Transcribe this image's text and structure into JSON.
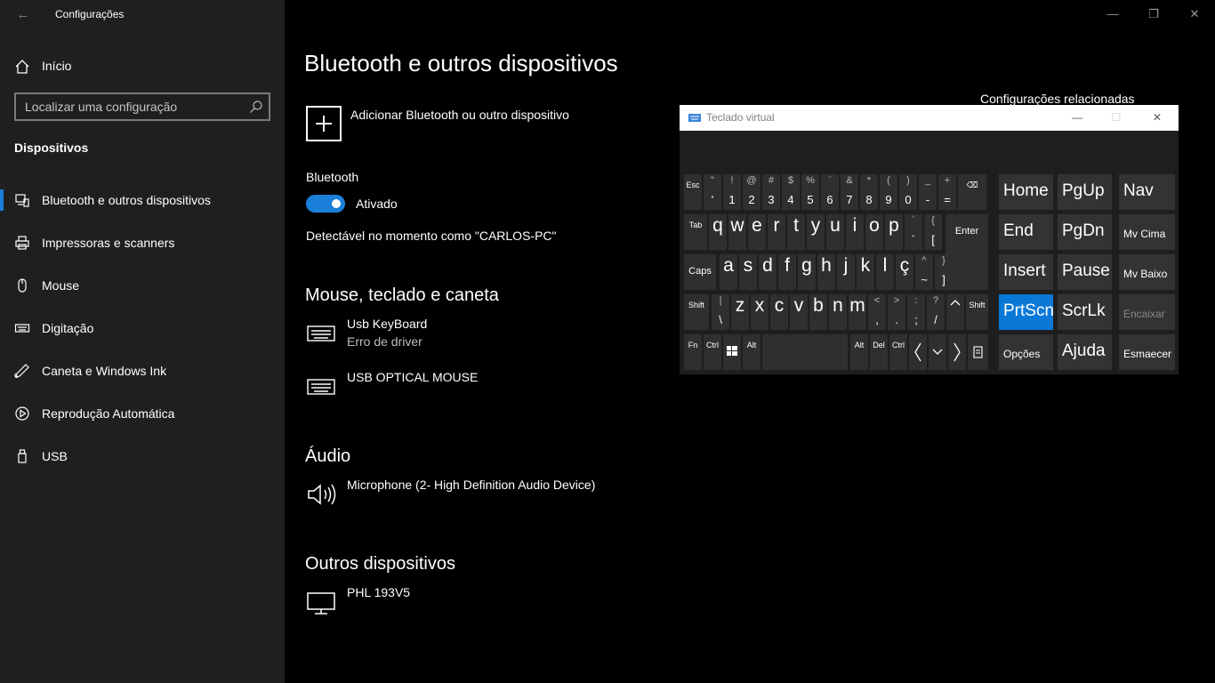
{
  "app_title": "Configurações",
  "sidebar": {
    "home_label": "Início",
    "search_placeholder": "Localizar uma configuração",
    "section": "Dispositivos",
    "items": [
      {
        "label": "Bluetooth e outros dispositivos",
        "icon": "bluetooth-devices-icon",
        "active": true
      },
      {
        "label": "Impressoras e scanners",
        "icon": "printer-icon"
      },
      {
        "label": "Mouse",
        "icon": "mouse-icon"
      },
      {
        "label": "Digitação",
        "icon": "keyboard-icon"
      },
      {
        "label": "Caneta e Windows Ink",
        "icon": "pen-icon"
      },
      {
        "label": "Reprodução Automática",
        "icon": "autoplay-icon"
      },
      {
        "label": "USB",
        "icon": "usb-icon"
      }
    ]
  },
  "main": {
    "title": "Bluetooth e outros dispositivos",
    "add_device": "Adicionar Bluetooth ou outro dispositivo",
    "bluetooth_label": "Bluetooth",
    "bluetooth_state": "Ativado",
    "bluetooth_on": true,
    "discoverable": "Detectável no momento como \"CARLOS-PC\"",
    "related": "Configurações relacionadas",
    "sections": {
      "input": {
        "title": "Mouse, teclado e caneta",
        "devices": [
          {
            "name": "Usb KeyBoard",
            "status": "Erro de driver",
            "icon": "keyboard-icon"
          },
          {
            "name": "USB OPTICAL MOUSE",
            "icon": "keyboard-icon"
          }
        ]
      },
      "audio": {
        "title": "Áudio",
        "devices": [
          {
            "name": "Microphone (2- High Definition Audio Device)",
            "icon": "speaker-icon"
          }
        ]
      },
      "other": {
        "title": "Outros dispositivos",
        "devices": [
          {
            "name": "PHL 193V5",
            "icon": "monitor-icon"
          }
        ]
      }
    }
  },
  "osk": {
    "title": "Teclado virtual",
    "row1": [
      {
        "main": "Esc",
        "small": true
      },
      {
        "top": "\"",
        "main": "'"
      },
      {
        "top": "!",
        "main": "1"
      },
      {
        "top": "@",
        "main": "2"
      },
      {
        "top": "#",
        "main": "3"
      },
      {
        "top": "$",
        "main": "4"
      },
      {
        "top": "%",
        "main": "5"
      },
      {
        "top": "¨",
        "main": "6"
      },
      {
        "top": "&",
        "main": "7"
      },
      {
        "top": "*",
        "main": "8"
      },
      {
        "top": "(",
        "main": "9"
      },
      {
        "top": ")",
        "main": "0"
      },
      {
        "top": "_",
        "main": "-"
      },
      {
        "top": "+",
        "main": "="
      },
      {
        "main": "⌫",
        "icon": "backspace-icon"
      }
    ],
    "row2": [
      "q",
      "w",
      "e",
      "r",
      "t",
      "y",
      "u",
      "i",
      "o",
      "p"
    ],
    "row2_extra": [
      {
        "top": "`",
        "main": "´"
      },
      {
        "top": "{",
        "main": "["
      }
    ],
    "row3": [
      "a",
      "s",
      "d",
      "f",
      "g",
      "h",
      "j",
      "k",
      "l",
      "ç"
    ],
    "row3_extra": [
      {
        "top": "^",
        "main": "~"
      },
      {
        "top": "}",
        "main": "]"
      }
    ],
    "row4": [
      "z",
      "x",
      "c",
      "v",
      "b",
      "n",
      "m"
    ],
    "row4_extra": [
      {
        "top": "<",
        "main": ","
      },
      {
        "top": ">",
        "main": "."
      },
      {
        "top": ":",
        "main": ";"
      },
      {
        "top": "?",
        "main": "/"
      }
    ],
    "labels": {
      "tab": "Tab",
      "caps": "Caps",
      "shift": "Shift",
      "shift_r": "Shift",
      "enter": "Enter",
      "fn": "Fn",
      "ctrl": "Ctrl",
      "alt": "Alt",
      "alt_r": "Alt",
      "del": "Del",
      "ctrl_r": "Ctrl",
      "backslash_top": "|",
      "backslash_main": "\\"
    },
    "nav_keys": [
      {
        "label": "Home"
      },
      {
        "label": "PgUp"
      },
      {
        "label": "Nav"
      },
      {
        "label": "End"
      },
      {
        "label": "PgDn"
      },
      {
        "label": "Mv Cima",
        "small": true
      },
      {
        "label": "Insert"
      },
      {
        "label": "Pause"
      },
      {
        "label": "Mv Baixo",
        "small": true
      },
      {
        "label": "PrtScn",
        "active": true
      },
      {
        "label": "ScrLk"
      },
      {
        "label": "Encaixar",
        "small": true,
        "dim": true
      },
      {
        "label": "Opções",
        "small": true
      },
      {
        "label": "Ajuda"
      },
      {
        "label": "Esmaecer",
        "small": true
      }
    ],
    "accent": "#0a78d7"
  },
  "colors": {
    "sidebar_bg": "#1f1f1f",
    "main_bg": "#000000",
    "accent": "#1a7fd9"
  }
}
